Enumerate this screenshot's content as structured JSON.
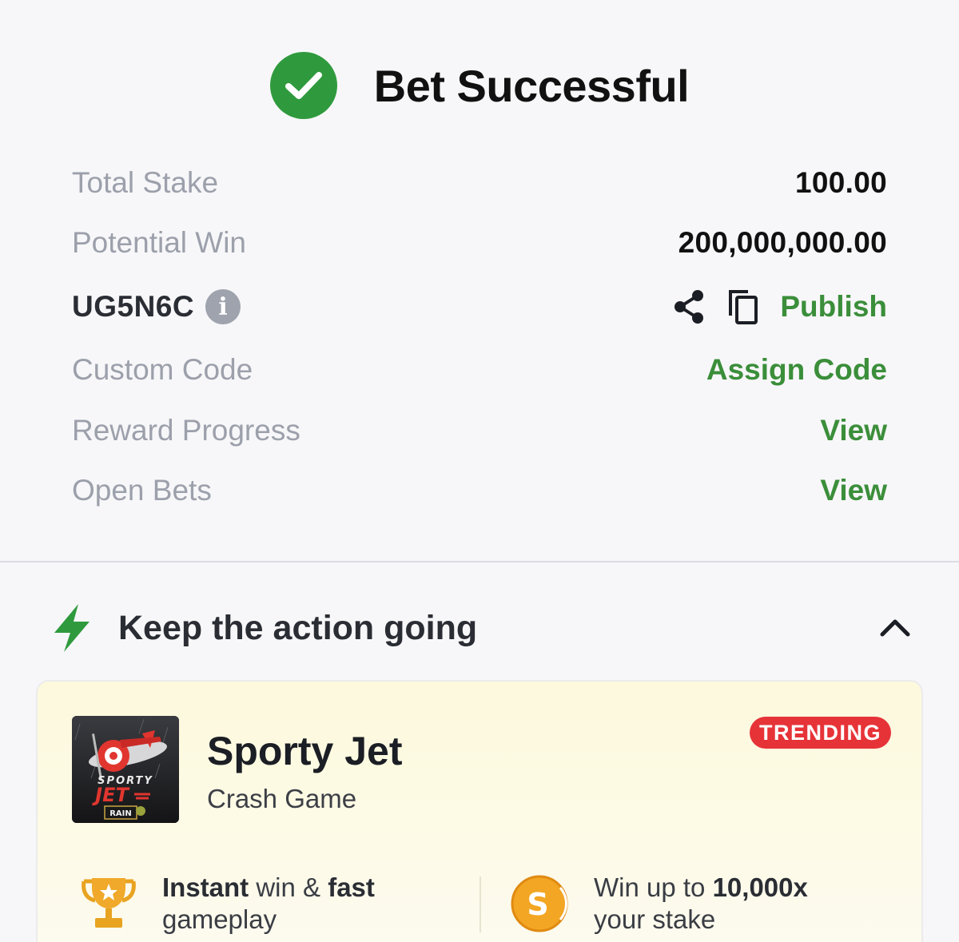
{
  "header": {
    "title": "Bet Successful",
    "icon": "check-circle-icon",
    "icon_color": "#2f9a3d"
  },
  "details": {
    "total_stake": {
      "label": "Total Stake",
      "value": "100.00"
    },
    "potential_win": {
      "label": "Potential Win",
      "value": "200,000,000.00"
    },
    "booking": {
      "code": "UG5N6C",
      "info_icon": "i",
      "publish_label": "Publish"
    },
    "custom_code": {
      "label": "Custom Code",
      "action": "Assign Code"
    },
    "reward_progress": {
      "label": "Reward Progress",
      "action": "View"
    },
    "open_bets": {
      "label": "Open Bets",
      "action": "View"
    }
  },
  "promo": {
    "section_title": "Keep the action going",
    "card": {
      "game_name": "Sporty Jet",
      "game_type": "Crash Game",
      "badge": "TRENDING",
      "thumb_text_1": "SPORTY",
      "thumb_text_2": "JET",
      "thumb_text_3": "RAIN",
      "feature_1": {
        "strong_1": "Instant",
        "text_1": " win & ",
        "strong_2": "fast",
        "line_2": "gameplay"
      },
      "feature_2": {
        "text_1": "Win up to ",
        "strong_1": "10,000x",
        "line_2": "your stake",
        "coin_symbol": "S"
      }
    }
  },
  "colors": {
    "accent_green": "#3b8e3a",
    "badge_red": "#e63338",
    "label_gray": "#9ca0ab"
  }
}
